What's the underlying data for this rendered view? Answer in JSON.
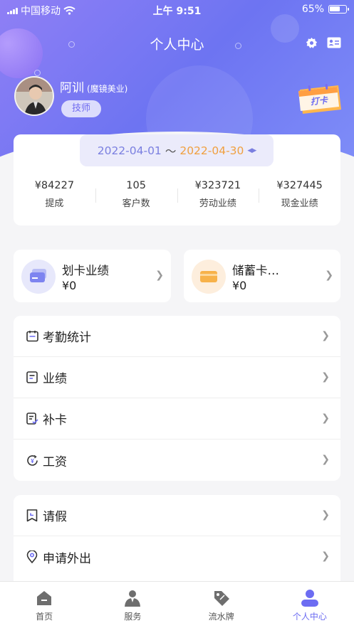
{
  "status_bar": {
    "carrier": "中国移动",
    "time": "上午 9:51",
    "battery": "65%"
  },
  "header": {
    "title": "个人中心"
  },
  "profile": {
    "name": "阿训",
    "store": "(魔镜美业)",
    "role": "技师",
    "punch_label": "打卡"
  },
  "date_range": {
    "start": "2022-04-01",
    "separator": "～",
    "end": "2022-04-30"
  },
  "stats": [
    {
      "value": "¥84227",
      "label": "提成"
    },
    {
      "value": "105",
      "label": "客户数"
    },
    {
      "value": "¥323721",
      "label": "劳动业绩"
    },
    {
      "value": "¥327445",
      "label": "现金业绩"
    }
  ],
  "cards": [
    {
      "title": "划卡业绩",
      "value": "¥0",
      "icon": "card-swipe-icon",
      "color": "#7d84f0"
    },
    {
      "title": "储蓄卡…",
      "value": "¥0",
      "icon": "savings-card-icon",
      "color": "#f7b24a"
    }
  ],
  "menu1": [
    {
      "label": "考勤统计",
      "icon": "calendar-icon"
    },
    {
      "label": "业绩",
      "icon": "document-icon"
    },
    {
      "label": "补卡",
      "icon": "document-check-icon"
    },
    {
      "label": "工资",
      "icon": "salary-icon"
    }
  ],
  "menu2": [
    {
      "label": "请假",
      "icon": "leave-icon"
    },
    {
      "label": "申请外出",
      "icon": "location-icon"
    }
  ],
  "tabs": [
    {
      "label": "首页",
      "icon": "home-icon"
    },
    {
      "label": "服务",
      "icon": "user-service-icon"
    },
    {
      "label": "流水牌",
      "icon": "tag-icon"
    },
    {
      "label": "个人中心",
      "icon": "profile-icon",
      "active": true
    }
  ],
  "colors": {
    "accent": "#6c6cf2",
    "date_end": "#f0a040"
  }
}
